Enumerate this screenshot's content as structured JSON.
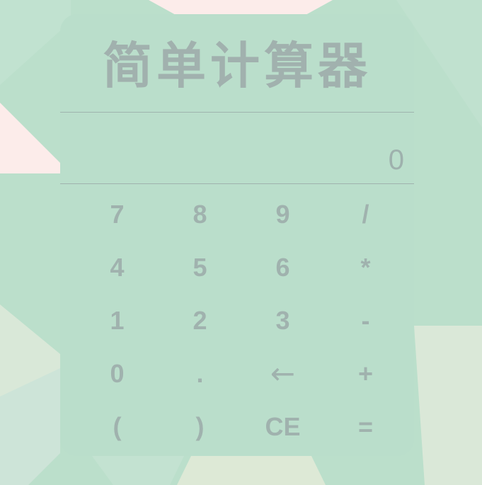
{
  "app": {
    "title": "简单计算器"
  },
  "display": {
    "value": "0"
  },
  "keypad": {
    "keys": [
      {
        "label": "7",
        "name": "key-7"
      },
      {
        "label": "8",
        "name": "key-8"
      },
      {
        "label": "9",
        "name": "key-9"
      },
      {
        "label": "/",
        "name": "key-divide"
      },
      {
        "label": "4",
        "name": "key-4"
      },
      {
        "label": "5",
        "name": "key-5"
      },
      {
        "label": "6",
        "name": "key-6"
      },
      {
        "label": "*",
        "name": "key-multiply"
      },
      {
        "label": "1",
        "name": "key-1"
      },
      {
        "label": "2",
        "name": "key-2"
      },
      {
        "label": "3",
        "name": "key-3"
      },
      {
        "label": "-",
        "name": "key-subtract"
      },
      {
        "label": "0",
        "name": "key-0"
      },
      {
        "label": ".",
        "name": "key-decimal"
      },
      {
        "label": "←",
        "name": "key-backspace"
      },
      {
        "label": "+",
        "name": "key-add"
      },
      {
        "label": "(",
        "name": "key-open-paren"
      },
      {
        "label": ")",
        "name": "key-close-paren"
      },
      {
        "label": "CE",
        "name": "key-clear"
      },
      {
        "label": "=",
        "name": "key-equals"
      }
    ]
  },
  "colors": {
    "background": "#bbdfcb",
    "panel": "#badecb",
    "text": "#a0b2ae",
    "rule": "#9fb3ae",
    "accent_pink": "#fcecea",
    "accent_cream": "#dbe8d7"
  }
}
